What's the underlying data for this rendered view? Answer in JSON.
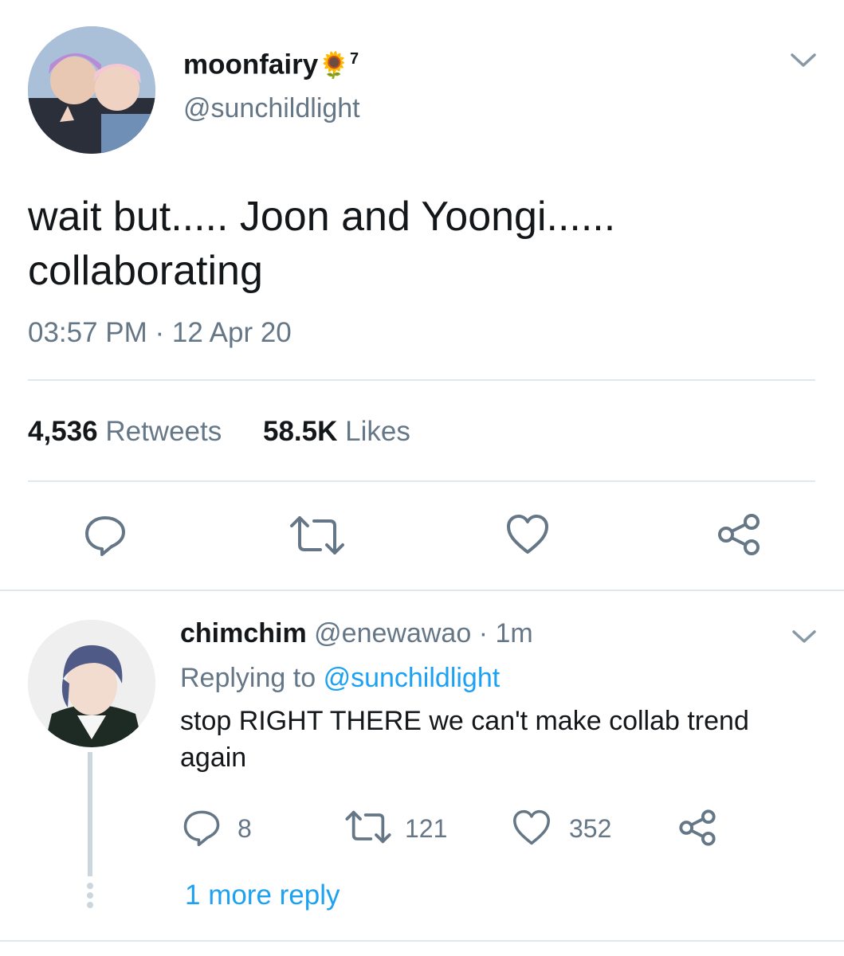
{
  "tweet": {
    "display_name": "moonfairy",
    "name_emoji": "🌻",
    "name_superscript": "7",
    "handle": "@sunchildlight",
    "text_line1": "wait but..... Joon and Yoongi......",
    "text_line2": "collaborating",
    "timestamp": "03:57 PM · 12 Apr 20",
    "retweets_count": "4,536",
    "retweets_label": "Retweets",
    "likes_count": "58.5K",
    "likes_label": "Likes"
  },
  "reply": {
    "display_name": "chimchim",
    "handle_time": "@enewawao · 1m",
    "replying_prefix": "Replying to",
    "replying_handle": "@sunchildlight",
    "text_line1": "stop RIGHT THERE we can't make collab trend",
    "text_line2": "again",
    "reply_count": "8",
    "retweet_count": "121",
    "like_count": "352",
    "more_replies": "1 more reply"
  },
  "icons": {
    "chevron": "chevron-down-icon",
    "reply": "reply-icon",
    "retweet": "retweet-icon",
    "like": "heart-icon",
    "share": "share-icon"
  },
  "colors": {
    "text": "#14171a",
    "muted": "#657786",
    "link": "#1da1f2",
    "divider": "#e1e8ed"
  }
}
